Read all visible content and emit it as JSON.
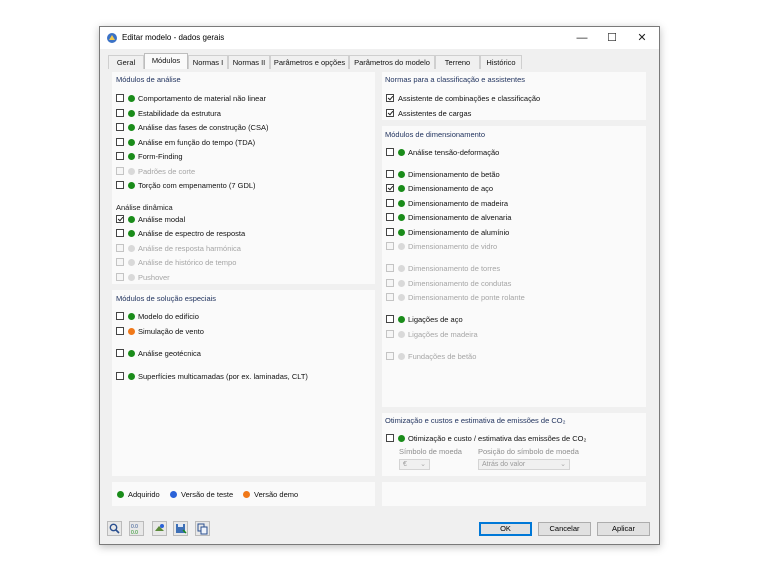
{
  "window": {
    "title": "Editar modelo - dados gerais"
  },
  "tabs": [
    "Geral",
    "Módulos",
    "Normas I",
    "Normas II",
    "Parâmetros e opções",
    "Parâmetros do modelo",
    "Terreno",
    "Histórico"
  ],
  "active_tab": "Módulos",
  "colors": {
    "acquired": "#1a8c1a",
    "test": "#2a62d8",
    "demo": "#f07818",
    "disabled_dot": "#d9d9d9"
  },
  "analysis": {
    "title": "Módulos de análise",
    "items": [
      {
        "label": "Comportamento de material não linear",
        "checked": false,
        "disabled": false,
        "status": "acquired"
      },
      {
        "label": "Estabilidade da estrutura",
        "checked": false,
        "disabled": false,
        "status": "acquired"
      },
      {
        "label": "Análise das fases de construção (CSA)",
        "checked": false,
        "disabled": false,
        "status": "acquired"
      },
      {
        "label": "Análise em função do tempo (TDA)",
        "checked": false,
        "disabled": false,
        "status": "acquired"
      },
      {
        "label": "Form-Finding",
        "checked": false,
        "disabled": false,
        "status": "acquired"
      },
      {
        "label": "Padrões de corte",
        "checked": false,
        "disabled": true,
        "status": "none"
      },
      {
        "label": "Torção com empenamento (7 GDL)",
        "checked": false,
        "disabled": false,
        "status": "acquired"
      }
    ],
    "dynamic_title": "Análise dinâmica",
    "dynamic_items": [
      {
        "label": "Análise modal",
        "checked": true,
        "disabled": false,
        "status": "acquired"
      },
      {
        "label": "Análise de espectro de resposta",
        "checked": false,
        "disabled": false,
        "status": "acquired"
      },
      {
        "label": "Análise de resposta harmónica",
        "checked": false,
        "disabled": true,
        "status": "none"
      },
      {
        "label": "Análise de histórico de tempo",
        "checked": false,
        "disabled": true,
        "status": "none"
      },
      {
        "label": "Pushover",
        "checked": false,
        "disabled": true,
        "status": "none"
      }
    ]
  },
  "special": {
    "title": "Módulos de solução especiais",
    "items": [
      {
        "label": "Modelo do edifício",
        "checked": false,
        "disabled": false,
        "status": "acquired"
      },
      {
        "label": "Simulação de vento",
        "checked": false,
        "disabled": false,
        "status": "demo"
      },
      {
        "label": "Análise geotécnica",
        "checked": false,
        "disabled": false,
        "status": "acquired"
      },
      {
        "label": "Superfícies multicamadas (por ex. laminadas, CLT)",
        "checked": false,
        "disabled": false,
        "status": "acquired"
      }
    ]
  },
  "norms": {
    "title": "Normas para a classificação e assistentes",
    "items": [
      {
        "label": "Assistente de combinações e classificação",
        "checked": true,
        "disabled": false
      },
      {
        "label": "Assistentes de cargas",
        "checked": true,
        "disabled": false
      }
    ]
  },
  "design": {
    "title": "Módulos de dimensionamento",
    "items": [
      {
        "label": "Análise tensão-deformação",
        "checked": false,
        "disabled": false,
        "status": "acquired"
      },
      {
        "label": "Dimensionamento de betão",
        "checked": false,
        "disabled": false,
        "status": "acquired"
      },
      {
        "label": "Dimensionamento de aço",
        "checked": true,
        "disabled": false,
        "status": "acquired"
      },
      {
        "label": "Dimensionamento de madeira",
        "checked": false,
        "disabled": false,
        "status": "acquired"
      },
      {
        "label": "Dimensionamento de alvenaria",
        "checked": false,
        "disabled": false,
        "status": "acquired"
      },
      {
        "label": "Dimensionamento de alumínio",
        "checked": false,
        "disabled": false,
        "status": "acquired"
      },
      {
        "label": "Dimensionamento de vidro",
        "checked": false,
        "disabled": true,
        "status": "none"
      },
      {
        "label": "Dimensionamento de torres",
        "checked": false,
        "disabled": true,
        "status": "none"
      },
      {
        "label": "Dimensionamento de condutas",
        "checked": false,
        "disabled": true,
        "status": "none"
      },
      {
        "label": "Dimensionamento de ponte rolante",
        "checked": false,
        "disabled": true,
        "status": "none"
      },
      {
        "label": "Ligações de aço",
        "checked": false,
        "disabled": false,
        "status": "acquired"
      },
      {
        "label": "Ligações de madeira",
        "checked": false,
        "disabled": true,
        "status": "none"
      },
      {
        "label": "Fundações de betão",
        "checked": false,
        "disabled": true,
        "status": "none"
      }
    ]
  },
  "optimization": {
    "title": "Otimização e custos e estimativa de emissões de CO₂",
    "item": {
      "label": "Otimização e custo / estimativa das emissões de CO₂",
      "checked": false,
      "status": "acquired"
    },
    "currency_symbol_label": "Símbolo de moeda",
    "currency_symbol_value": "€",
    "currency_position_label": "Posição do símbolo de moeda",
    "currency_position_value": "Atrás do valor"
  },
  "legend": {
    "acquired": "Adquirido",
    "test": "Versão de teste",
    "demo": "Versão demo"
  },
  "toolbar_icons": [
    "search-icon",
    "units-icon",
    "model-info-icon",
    "save-icon",
    "copy-icon"
  ],
  "buttons": {
    "ok": "OK",
    "cancel": "Cancelar",
    "apply": "Aplicar"
  }
}
